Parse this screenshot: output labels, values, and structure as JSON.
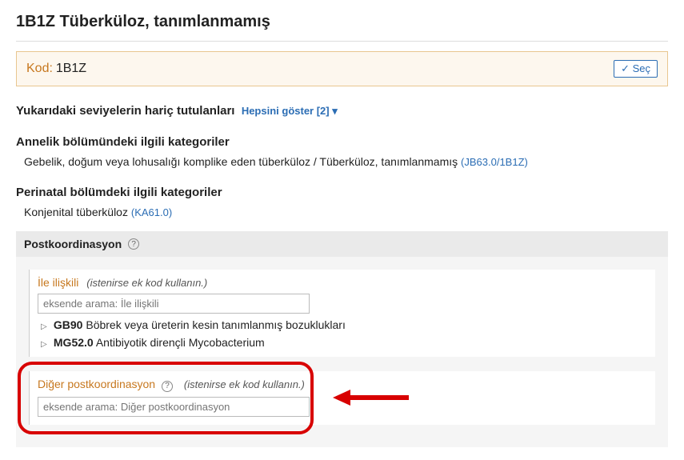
{
  "title": "1B1Z Tüberküloz, tanımlanmamış",
  "code_bar": {
    "label": "Kod:",
    "value": "1B1Z",
    "select": "✓ Seç"
  },
  "exclusions": {
    "label": "Yukarıdaki seviyelerin hariç tutulanları",
    "show_all": "Hepsini göster [2] ▾"
  },
  "maternal": {
    "header": "Annelik bölümündeki ilgili kategoriler",
    "text": "Gebelik, doğum veya lohusalığı komplike eden tüberküloz / Tüberküloz, tanımlanmamış",
    "link": "(JB63.0/1B1Z)"
  },
  "perinatal": {
    "header": "Perinatal bölümdeki ilgili kategoriler",
    "text": "Konjenital tüberküloz",
    "link": "(KA61.0)"
  },
  "postcoord": {
    "header": "Postkoordinasyon",
    "associated": {
      "title": "İle ilişkili",
      "hint": "(istenirse ek kod kullanın.)",
      "placeholder": "eksende arama: İle ilişkili",
      "items": [
        {
          "code": "GB90",
          "text": "Böbrek veya üreterin kesin tanımlanmış bozuklukları"
        },
        {
          "code": "MG52.0",
          "text": "Antibiyotik dirençli Mycobacterium"
        }
      ]
    },
    "other": {
      "title": "Diğer postkoordinasyon",
      "hint": "(istenirse ek kod kullanın.)",
      "placeholder": "eksende arama: Diğer postkoordinasyon"
    }
  }
}
